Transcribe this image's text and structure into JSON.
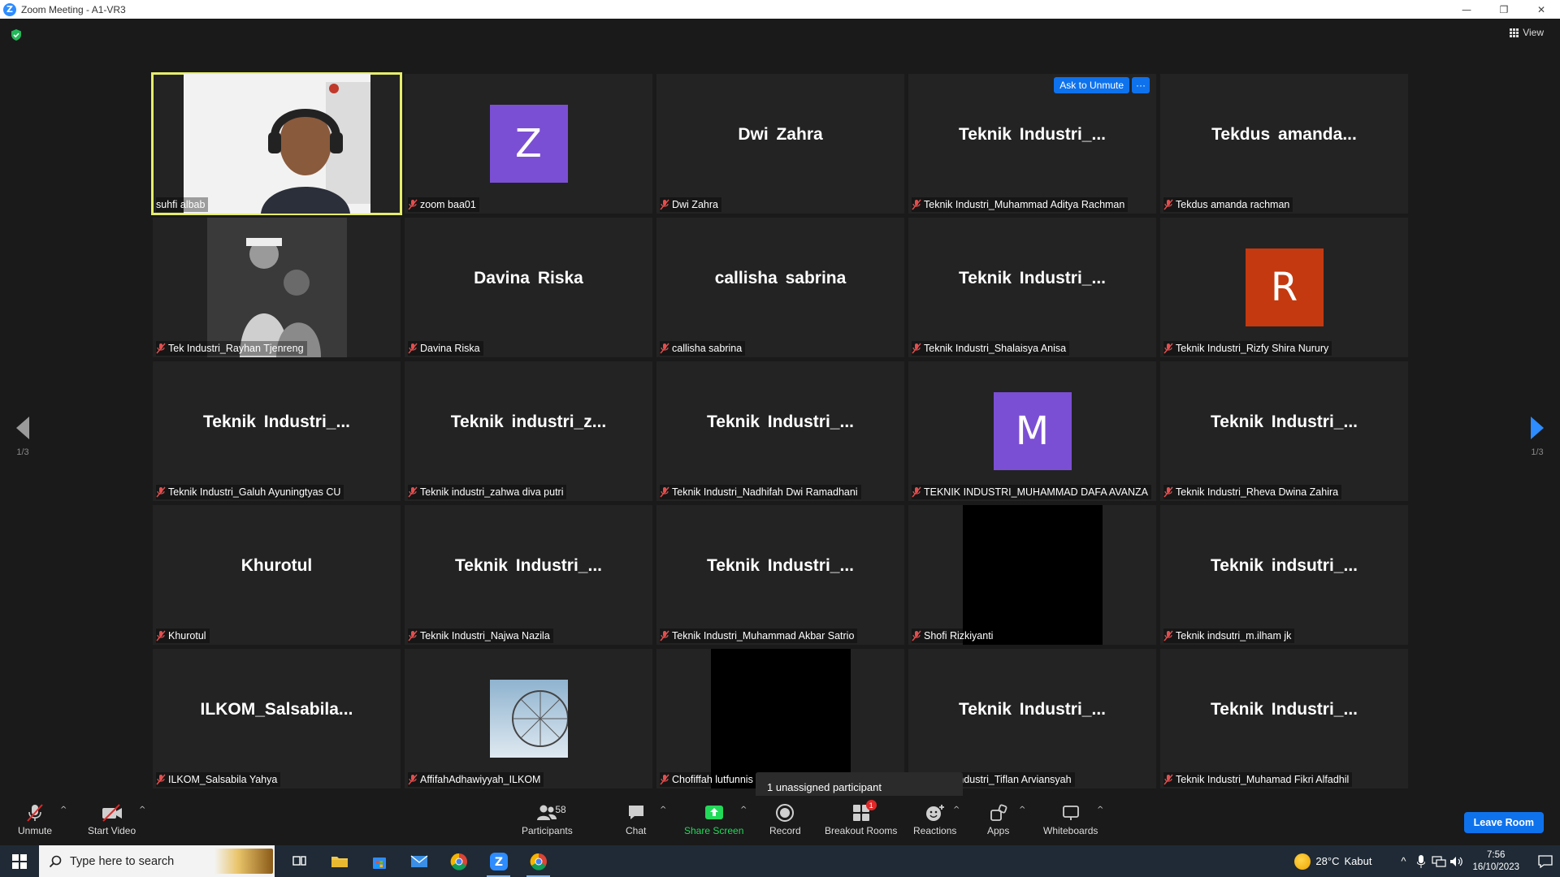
{
  "window": {
    "title": "Zoom Meeting - A1-VR3",
    "logo_letter": "Z",
    "minimize": "—",
    "restore": "❐",
    "close": "✕"
  },
  "header": {
    "view_label": "View"
  },
  "tiles": [
    {
      "type": "video",
      "name": "suhfi albab",
      "active": true,
      "muted": false
    },
    {
      "type": "avatar",
      "letter": "Z",
      "color": "#7b4fd4",
      "name": "zoom baa01",
      "muted": true
    },
    {
      "type": "text",
      "display": "Dwi Zahra",
      "name": "Dwi Zahra",
      "muted": true
    },
    {
      "type": "text",
      "display": "Teknik Industri_...",
      "name": "Teknik Industri_Muhammad Aditya Rachman",
      "muted": true,
      "actions": {
        "ask": "Ask to Unmute",
        "more": "···"
      }
    },
    {
      "type": "text",
      "display": "Tekdus amanda...",
      "name": "Tekdus amanda rachman",
      "muted": true
    },
    {
      "type": "photo",
      "name": "Tek Industri_Rayhan Tjenreng",
      "muted": true
    },
    {
      "type": "text",
      "display": "Davina Riska",
      "name": "Davina Riska",
      "muted": true
    },
    {
      "type": "text",
      "display": "callisha sabrina",
      "name": "callisha sabrina",
      "muted": true
    },
    {
      "type": "text",
      "display": "Teknik Industri_...",
      "name": "Teknik Industri_Shalaisya Anisa",
      "muted": true
    },
    {
      "type": "avatar",
      "letter": "R",
      "color": "#c4390f",
      "name": "Teknik Industri_Rizfy Shira Nurury",
      "muted": true
    },
    {
      "type": "text",
      "display": "Teknik Industri_...",
      "name": "Teknik Industri_Galuh Ayuningtyas CU",
      "muted": true
    },
    {
      "type": "text",
      "display": "Teknik industri_z...",
      "name": "Teknik industri_zahwa diva putri",
      "muted": true
    },
    {
      "type": "text",
      "display": "Teknik Industri_...",
      "name": "Teknik Industri_Nadhifah Dwi Ramadhani",
      "muted": true
    },
    {
      "type": "avatar",
      "letter": "M",
      "color": "#7b4fd4",
      "name": "TEKNIK INDUSTRI_MUHAMMAD DAFA AVANZA",
      "muted": true
    },
    {
      "type": "text",
      "display": "Teknik Industri_...",
      "name": "Teknik Industri_Rheva Dwina Zahira",
      "muted": true
    },
    {
      "type": "text",
      "display": "Khurotul",
      "name": "Khurotul",
      "muted": true
    },
    {
      "type": "text",
      "display": "Teknik Industri_...",
      "name": "Teknik Industri_Najwa Nazila",
      "muted": true
    },
    {
      "type": "text",
      "display": "Teknik Industri_...",
      "name": "Teknik Industri_Muhammad Akbar Satrio",
      "muted": true
    },
    {
      "type": "black",
      "name": "Shofi Rizkiyanti",
      "muted": true
    },
    {
      "type": "text",
      "display": "Teknik indsutri_...",
      "name": "Teknik indsutri_m.ilham jk",
      "muted": true
    },
    {
      "type": "text",
      "display": "ILKOM_Salsabila...",
      "name": "ILKOM_Salsabila Yahya",
      "muted": true
    },
    {
      "type": "sky",
      "name": "AffifahAdhawiyyah_ILKOM",
      "muted": true
    },
    {
      "type": "black",
      "name": "Chofiffah lutfunnis",
      "muted": true
    },
    {
      "type": "text",
      "display": "Teknik Industri_...",
      "name": "Teknik Industri_Tiflan Arviansyah",
      "muted": true
    },
    {
      "type": "text",
      "display": "Teknik Industri_...",
      "name": "Teknik Industri_Muhamad Fikri Alfadhil",
      "muted": true
    }
  ],
  "pagination": {
    "left": "1/3",
    "right": "1/3"
  },
  "tooltip": {
    "text": "1 unassigned participant"
  },
  "toolbar": {
    "unmute": "Unmute",
    "start_video": "Start Video",
    "participants": "Participants",
    "participant_count": "58",
    "chat": "Chat",
    "share_screen": "Share Screen",
    "record": "Record",
    "breakout_rooms": "Breakout Rooms",
    "breakout_badge": "1",
    "reactions": "Reactions",
    "apps": "Apps",
    "whiteboards": "Whiteboards",
    "leave": "Leave Room",
    "caret": "^"
  },
  "taskbar": {
    "search_placeholder": "Type here to search",
    "temperature": "28°C",
    "weather": "Kabut",
    "time": "7:56",
    "date": "16/10/2023",
    "chevron": "^"
  },
  "colors": {
    "accent": "#0e72ed",
    "active_speaker": "#e6ee6b",
    "share_green": "#23d959",
    "mute_red": "#e02828"
  }
}
